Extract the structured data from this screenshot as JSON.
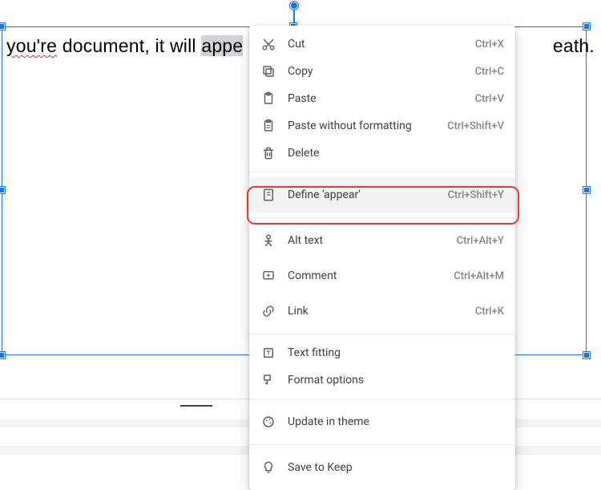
{
  "document": {
    "leading_text": " ",
    "word_spellerr": "you're",
    "mid_text_1": " document, it will ",
    "selected_word": "appe",
    "trailing_text": "eath."
  },
  "context_menu": {
    "items": [
      {
        "icon": "cut-icon",
        "label": "Cut",
        "shortcut": "Ctrl+X"
      },
      {
        "icon": "copy-icon",
        "label": "Copy",
        "shortcut": "Ctrl+C"
      },
      {
        "icon": "paste-icon",
        "label": "Paste",
        "shortcut": "Ctrl+V"
      },
      {
        "icon": "paste-plain-icon",
        "label": "Paste without formatting",
        "shortcut": "Ctrl+Shift+V"
      },
      {
        "icon": "delete-icon",
        "label": "Delete",
        "shortcut": ""
      }
    ],
    "define": {
      "icon": "dictionary-icon",
      "label": "Define 'appear'",
      "shortcut": "Ctrl+Shift+Y"
    },
    "alt_text": {
      "icon": "alt-text-icon",
      "label": "Alt text",
      "shortcut": "Ctrl+Alt+Y"
    },
    "comment": {
      "icon": "comment-icon",
      "label": "Comment",
      "shortcut": "Ctrl+Alt+M"
    },
    "link": {
      "icon": "link-icon",
      "label": "Link",
      "shortcut": "Ctrl+K"
    },
    "text_fitting": {
      "icon": "text-fitting-icon",
      "label": "Text fitting",
      "shortcut": ""
    },
    "format_options": {
      "icon": "format-options-icon",
      "label": "Format options",
      "shortcut": ""
    },
    "update_theme": {
      "icon": "theme-icon",
      "label": "Update in theme",
      "shortcut": ""
    },
    "save_keep": {
      "icon": "keep-icon",
      "label": "Save to Keep",
      "shortcut": ""
    }
  }
}
